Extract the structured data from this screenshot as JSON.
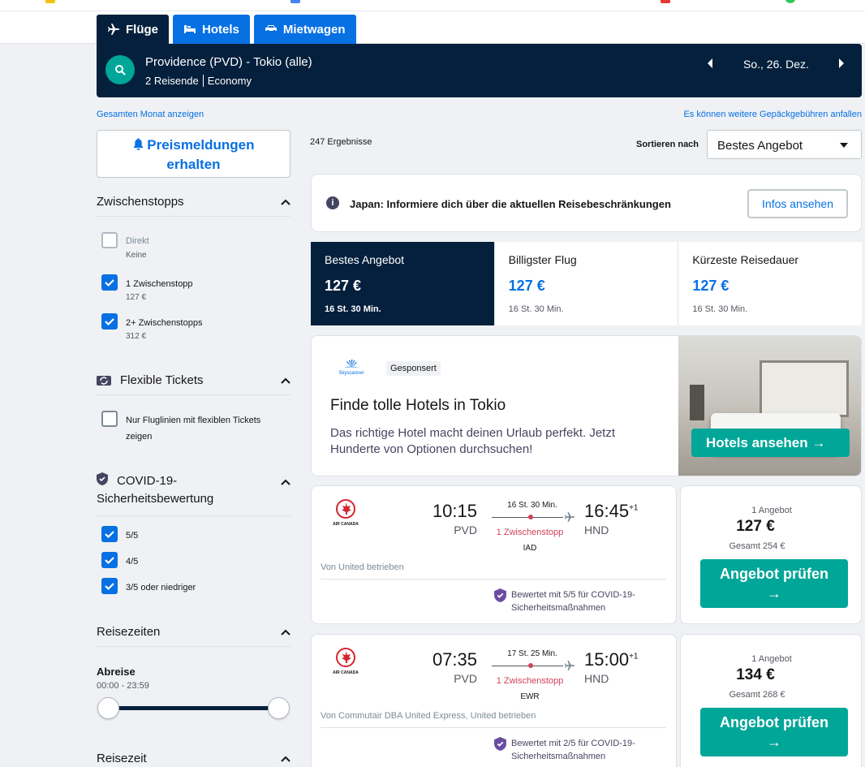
{
  "tabs": [
    {
      "label": "Flüge",
      "icon": "plane-icon",
      "active": true
    },
    {
      "label": "Hotels",
      "icon": "bed-icon",
      "active": false
    },
    {
      "label": "Mietwagen",
      "icon": "car-icon",
      "active": false
    }
  ],
  "search": {
    "route": "Providence (PVD) - Tokio (alle)",
    "travellers": "2 Reisende",
    "cabin": "Economy",
    "date": "So., 26. Dez."
  },
  "links": {
    "month": "Gesamten Monat anzeigen",
    "baggage": "Es können weitere Gepäckgebühren anfallen"
  },
  "price_alert": {
    "line1": "Preismeldungen",
    "line2": "erhalten"
  },
  "filters": {
    "stops": {
      "title": "Zwischenstopps",
      "options": [
        {
          "label": "Direkt",
          "sub": "Keine",
          "state": "disabled"
        },
        {
          "label": "1 Zwischenstopp",
          "sub": "127 €",
          "state": "checked"
        },
        {
          "label": "2+ Zwischenstopps",
          "sub": "312 €",
          "state": "checked"
        }
      ]
    },
    "flexible": {
      "title": "Flexible Tickets",
      "option_line1": "Nur Fluglinien mit flexiblen Tickets",
      "option_line2": "zeigen"
    },
    "covid": {
      "title_line1": "COVID-19-",
      "title_line2": "Sicherheitsbewertung",
      "options": [
        "5/5",
        "4/5",
        "3/5 oder niedriger"
      ]
    },
    "times": {
      "title": "Reisezeiten",
      "departure_label": "Abreise",
      "departure_range": "00:00 - 23:59"
    },
    "duration": {
      "title": "Reisezeit"
    }
  },
  "results": {
    "count": "247 Ergebnisse",
    "sort_label": "Sortieren nach",
    "sort_value": "Bestes Angebot"
  },
  "notice": {
    "text": "Japan: Informiere dich über die aktuellen Reisebeschränkungen",
    "button": "Infos ansehen"
  },
  "sort_tabs": [
    {
      "title": "Bestes Angebot",
      "price": "127 €",
      "duration": "16 St. 30 Min.",
      "active": true
    },
    {
      "title": "Billigster Flug",
      "price": "127 €",
      "duration": "16 St. 30 Min.",
      "active": false
    },
    {
      "title": "Kürzeste Reisedauer",
      "price": "127 €",
      "duration": "16 St. 30 Min.",
      "active": false
    }
  ],
  "ad": {
    "logo_text": "Skyscanner",
    "badge": "Gesponsert",
    "title": "Finde tolle Hotels in Tokio",
    "desc": "Das richtige Hotel macht deinen Urlaub perfekt. Jetzt Hunderte von Optionen durchsuchen!",
    "button": "Hotels ansehen →"
  },
  "flights": [
    {
      "airline": "AIR CANADA",
      "dep_time": "10:15",
      "dep_code": "PVD",
      "arr_time": "16:45",
      "arr_plus": "+1",
      "arr_code": "HND",
      "duration": "16 St. 30 Min.",
      "stops": "1 Zwischenstopp",
      "via": "IAD",
      "operated": "Von United betrieben",
      "covid_line1": "Bewertet mit 5/5 für COVID-19-",
      "covid_line2": "Sicherheitsmaßnahmen",
      "offers": "1 Angebot",
      "price": "127 €",
      "total": "Gesamt 254 €",
      "button_line1": "Angebot prüfen",
      "button_line2": "→"
    },
    {
      "airline": "AIR CANADA",
      "dep_time": "07:35",
      "dep_code": "PVD",
      "arr_time": "15:00",
      "arr_plus": "+1",
      "arr_code": "HND",
      "duration": "17 St. 25 Min.",
      "stops": "1 Zwischenstopp",
      "via": "EWR",
      "operated": "Von Commutair DBA United Express, United betrieben",
      "covid_line1": "Bewertet mit 2/5 für COVID-19-",
      "covid_line2": "Sicherheitsmaßnahmen",
      "offers": "1 Angebot",
      "price": "134 €",
      "total": "Gesamt 268 €",
      "button_line1": "Angebot prüfen",
      "button_line2": "→"
    }
  ],
  "colors": {
    "navy": "#05203c",
    "blue": "#0770e3",
    "teal": "#00a698",
    "red": "#d1435b"
  }
}
